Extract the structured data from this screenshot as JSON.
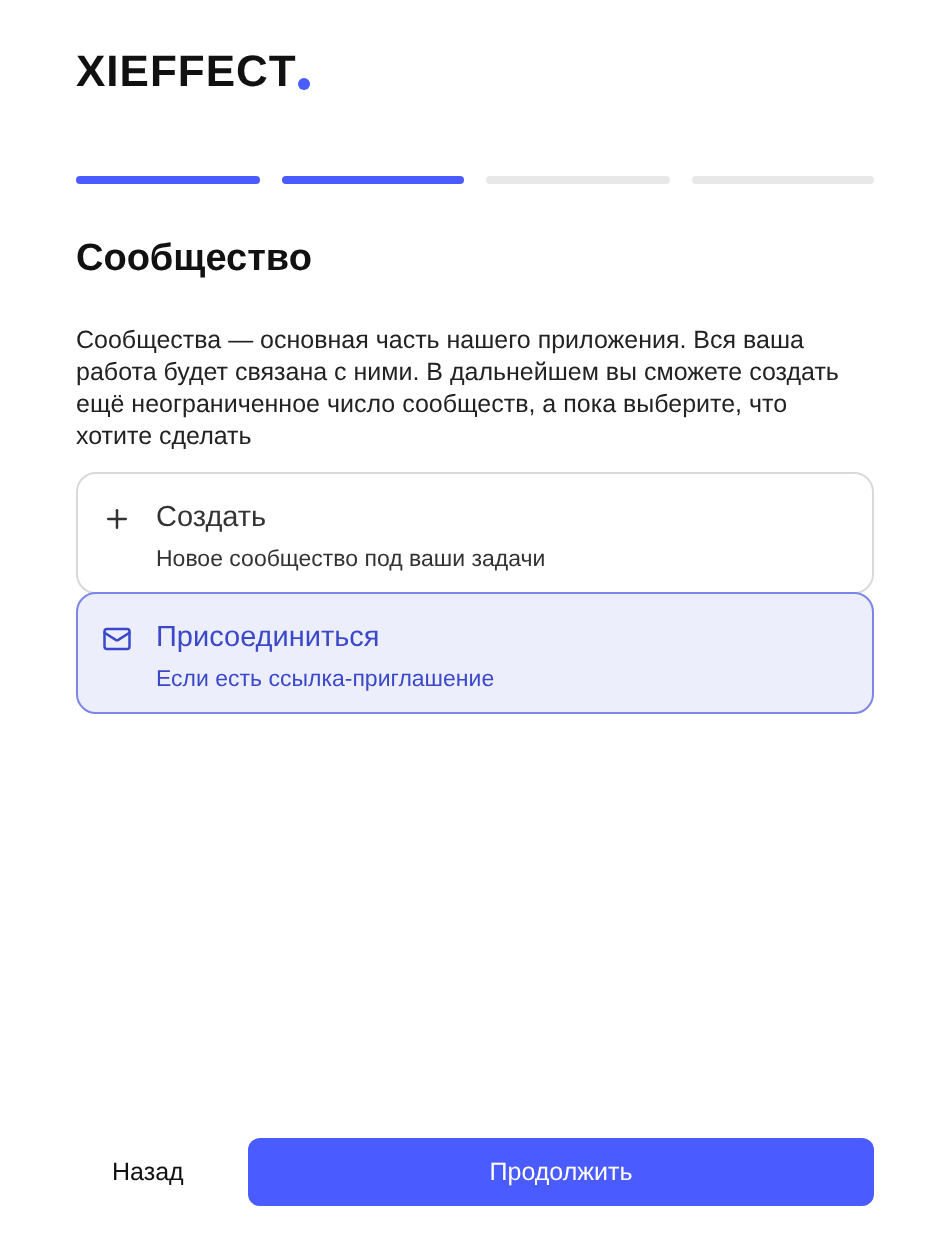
{
  "logo": {
    "text": "XIEFFECT"
  },
  "steps": [
    {
      "done": true
    },
    {
      "done": true
    },
    {
      "done": false
    },
    {
      "done": false
    }
  ],
  "heading": "Сообщество",
  "description": "Сообщества — основная часть нашего приложения. Вся ваша работа будет связана с ними. В дальнейшем вы сможете создать ещё неограниченное число сообществ, а пока выберите, что хотите сделать",
  "options": [
    {
      "kind": "create",
      "title": "Создать",
      "subtitle": "Новое сообщество под ваши задачи",
      "selected": false
    },
    {
      "kind": "join",
      "title": "Присоединиться",
      "subtitle": "Если есть ссылка-приглашение",
      "selected": true
    }
  ],
  "buttons": {
    "back": "Назад",
    "continue": "Продолжить"
  }
}
